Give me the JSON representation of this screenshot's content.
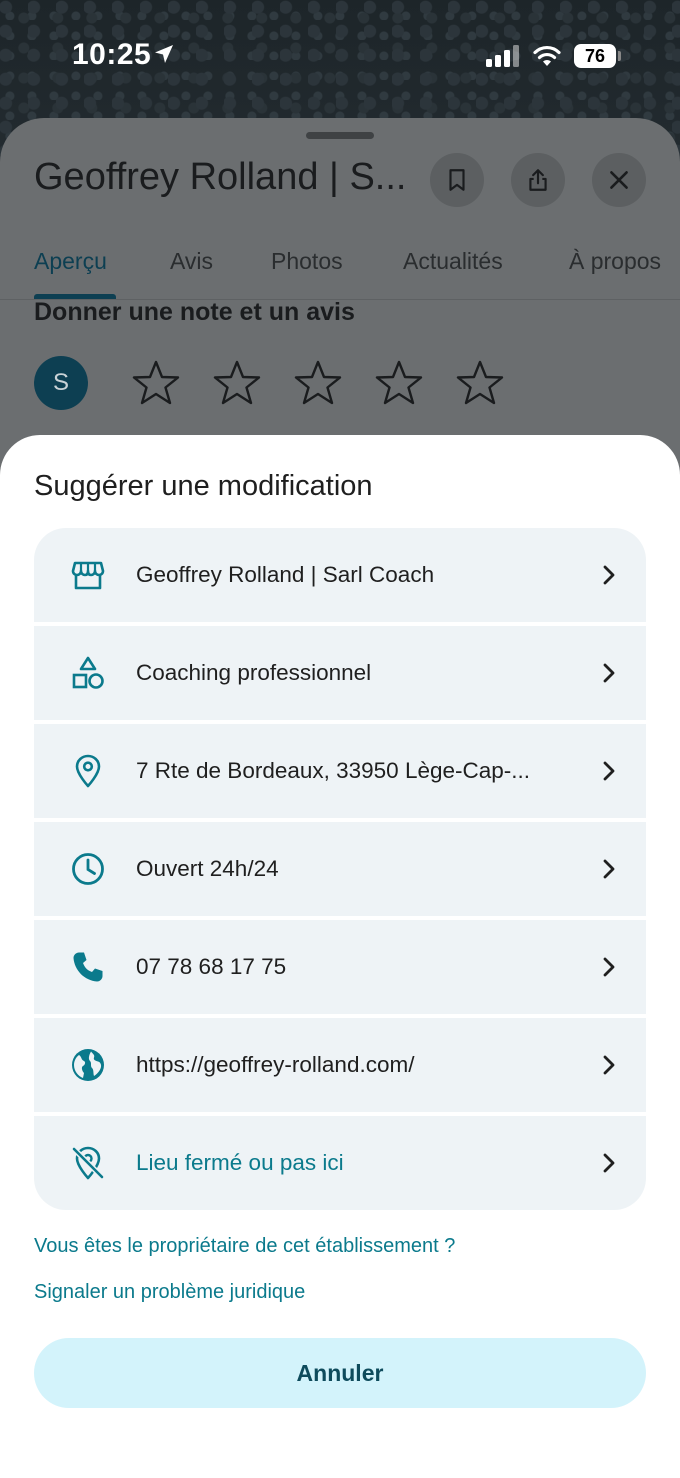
{
  "status_bar": {
    "time": "10:25",
    "battery": "76"
  },
  "place": {
    "title": "Geoffrey Rolland | S...",
    "tabs": [
      "Aperçu",
      "Avis",
      "Photos",
      "Actualités",
      "À propos"
    ],
    "active_tab": "Aperçu",
    "review_heading": "Donner une note et un avis",
    "avatar_initial": "S",
    "star_rating": 0
  },
  "sheet": {
    "title": "Suggérer une modification",
    "items": [
      {
        "icon": "store-icon",
        "label": "Geoffrey Rolland | Sarl Coach"
      },
      {
        "icon": "category-icon",
        "label": "Coaching professionnel"
      },
      {
        "icon": "location-pin-icon",
        "label": "7 Rte de Bordeaux, 33950 Lège-Cap-..."
      },
      {
        "icon": "clock-icon",
        "label": "Ouvert 24h/24"
      },
      {
        "icon": "phone-icon",
        "label": "07 78 68 17 75"
      },
      {
        "icon": "globe-icon",
        "label": "https://geoffrey-rolland.com/"
      },
      {
        "icon": "location-off-icon",
        "label": "Lieu fermé ou pas ici"
      }
    ],
    "owner_link": "Vous êtes le propriétaire de cet établissement ?",
    "legal_link": "Signaler un problème juridique",
    "cancel_label": "Annuler"
  },
  "colors": {
    "accent": "#0b7a8c",
    "row_bg": "#eef3f6",
    "cancel_bg": "#d3f3fb"
  }
}
